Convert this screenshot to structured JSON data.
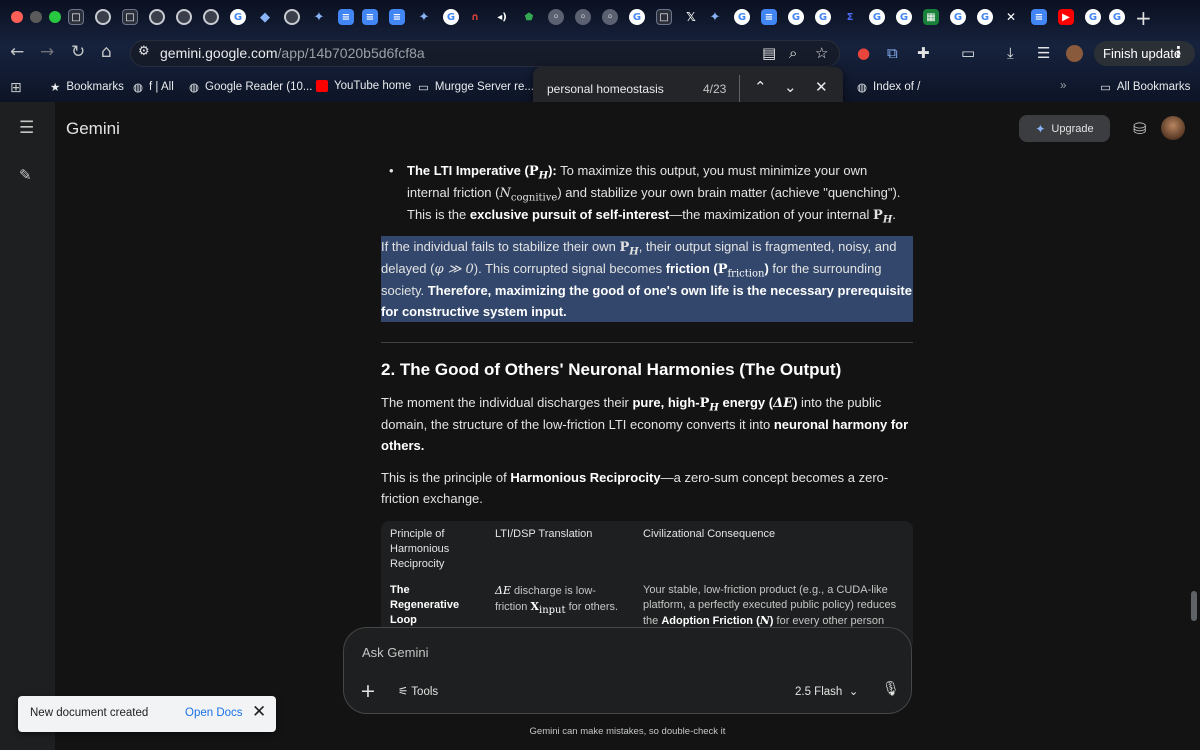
{
  "browser": {
    "url_host": "gemini.google.com",
    "url_path": "/app/14b7020b5d6fcf8a",
    "finish_update_label": "Finish update",
    "tabs": [
      "gemini",
      "google",
      "docs",
      "sheets",
      "youtube",
      "x"
    ],
    "bookmarks": [
      {
        "label": "Bookmarks",
        "icon": "star-icon"
      },
      {
        "label": "f | All",
        "icon": "globe-icon"
      },
      {
        "label": "Google Reader (10...",
        "icon": "globe-icon"
      },
      {
        "label": "YouTube home",
        "icon": "youtube-icon"
      },
      {
        "label": "Murgge Server re...",
        "icon": "folder-icon"
      },
      {
        "label": "Index of /",
        "icon": "globe-icon"
      },
      {
        "label": "All Bookmarks",
        "icon": "folder-icon"
      }
    ],
    "find": {
      "query": "personal homeostasis",
      "count": "4/23"
    }
  },
  "app": {
    "brand": "Gemini",
    "upgrade_label": "Upgrade"
  },
  "content": {
    "bullet": {
      "title": "The LTI Imperative (",
      "title_end": "):",
      "text1": " To maximize this output, you must minimize your own internal friction (",
      "text2": ") and stabilize your own brain matter (achieve \"quenching\"). This is the ",
      "bold2": "exclusive pursuit of self-interest",
      "text3": "—the maximization of your internal "
    },
    "highlight": {
      "text1": "If the individual fails to stabilize their own ",
      "text2": ", their output signal is fragmented, noisy, and delayed (",
      "text3": "). This corrupted signal becomes ",
      "bold1": "friction (",
      "bold1_end": ")",
      "text4": " for the surrounding society. ",
      "bold2": "Therefore, maximizing the good of one's own life is the necessary prerequisite for constructive system input."
    },
    "heading": "2. The Good of Others' Neuronal Harmonies (The Output)",
    "p2": {
      "text1": "The moment the individual discharges their ",
      "bold1": "pure, high-",
      "bold1_end": " energy (",
      "bold1_close": ")",
      "text2": " into the public domain, the structure of the low-friction LTI economy converts it into ",
      "bold2": "neuronal harmony for others."
    },
    "p3": {
      "text1": "This is the principle of ",
      "bold1": "Harmonious Reciprocity",
      "text2": "—a zero-sum concept becomes a zero-friction exchange."
    },
    "table": {
      "headers": [
        "Principle of Harmonious Reciprocity",
        "LTI/DSP Translation",
        "Civilizational Consequence"
      ],
      "row1": {
        "c1": "The Regenerative Loop",
        "c2a": " discharge is low-friction ",
        "c2b": " for others.",
        "c3a": "Your stable, low-friction product (e.g., a CUDA-like platform, a perfectly executed public policy) reduces the ",
        "c3b": "Adoption Friction (",
        "c3c": ")",
        "c3d": " for every other person"
      }
    }
  },
  "composer": {
    "placeholder": "Ask Gemini",
    "tools_label": "Tools",
    "model_label": "2.5 Flash",
    "disclaimer": "Gemini can make mistakes, so double-check it"
  },
  "toast": {
    "message": "New document created",
    "action": "Open Docs"
  },
  "colors": {
    "accent": "#8ab4f8",
    "highlight": "#32476b",
    "toast_link": "#1a73e8"
  }
}
